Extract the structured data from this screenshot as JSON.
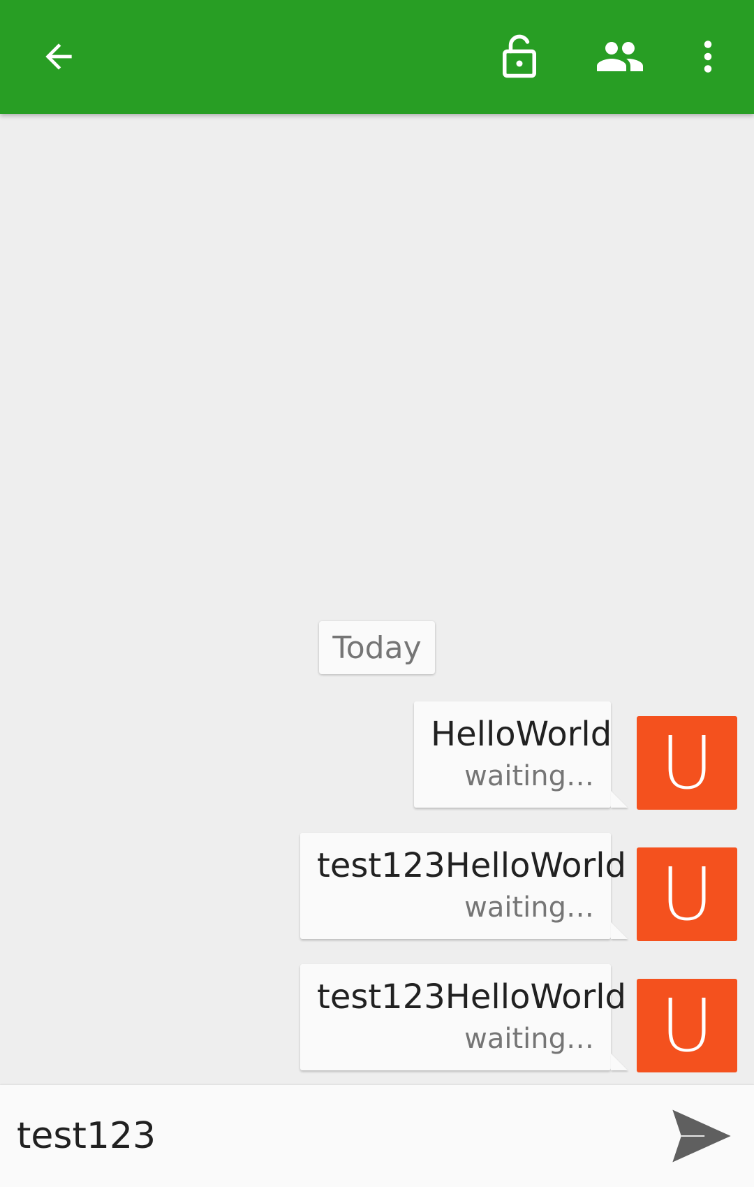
{
  "colors": {
    "toolbar": "#289e24",
    "avatar": "#f4511e",
    "background": "#eeeeee",
    "bubble": "#fafafa",
    "send_icon": "#5f5f5f"
  },
  "toolbar": {
    "back_icon": "arrow-back-icon",
    "lock_icon": "lock-open-icon",
    "people_icon": "people-icon",
    "more_icon": "more-vert-icon"
  },
  "conversation": {
    "date_label": "Today",
    "messages": [
      {
        "text": "HelloWorld",
        "status": "waiting…",
        "avatar_letter": "U"
      },
      {
        "text": "test123HelloWorld",
        "status": "waiting…",
        "avatar_letter": "U"
      },
      {
        "text": "test123HelloWorld",
        "status": "waiting…",
        "avatar_letter": "U"
      }
    ]
  },
  "composer": {
    "value": "test123",
    "send_icon": "send-icon"
  }
}
